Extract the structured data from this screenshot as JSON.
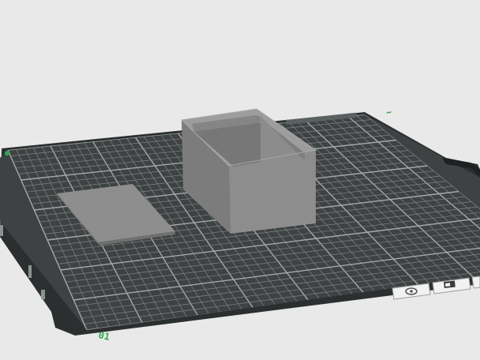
{
  "viewport": {
    "background_color": "#e9e9e9",
    "bed_color": "#3e4243",
    "grid_line_color": "#7f8485",
    "bed_edge_color": "#2a2d2e",
    "accent_color": "#2ea84a"
  },
  "bed": {
    "axis_label_y": "01",
    "axis_label_x": "Y",
    "corner_marker_label": ""
  },
  "objects": [
    {
      "name": "box",
      "color": "#8a8a8a"
    },
    {
      "name": "lid",
      "color": "#8e8e8e"
    }
  ],
  "toolbar": {
    "buttons": [
      {
        "name": "view-icon",
        "title": "view"
      },
      {
        "name": "layer-icon",
        "title": "layer"
      }
    ]
  }
}
